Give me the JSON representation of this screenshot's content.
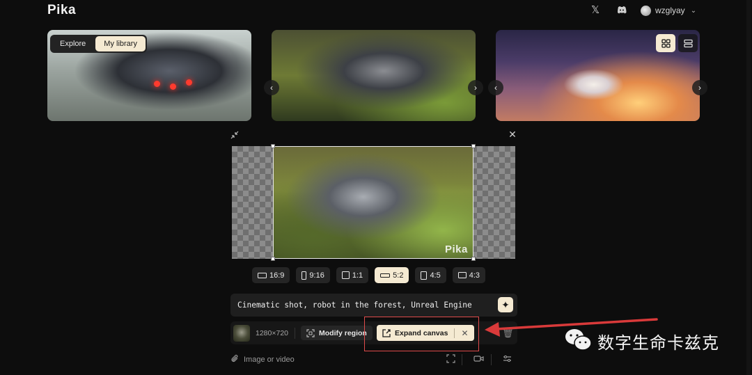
{
  "app": {
    "logo": "Pika"
  },
  "header": {
    "x_icon": "x-twitter-icon",
    "discord_icon": "discord-icon",
    "username": "wzglyay"
  },
  "gallery": {
    "tabs": [
      {
        "label": "Explore",
        "active": false
      },
      {
        "label": "My library",
        "active": true
      }
    ],
    "view_modes": [
      "grid-view",
      "list-view"
    ]
  },
  "editor": {
    "watermark": "Pika",
    "aspect_ratios": [
      {
        "label": "16:9",
        "active": false
      },
      {
        "label": "9:16",
        "active": false
      },
      {
        "label": "1:1",
        "active": false
      },
      {
        "label": "5:2",
        "active": true
      },
      {
        "label": "4:5",
        "active": false
      },
      {
        "label": "4:3",
        "active": false
      }
    ],
    "prompt": "Cinematic shot, robot in the forest, Unreal Engine",
    "resolution": "1280×720",
    "modify_region_label": "Modify region",
    "expand_canvas_label": "Expand canvas",
    "attach_label": "Image or video"
  },
  "overlay": {
    "wechat_text": "数字生命卡兹克",
    "highlight_color": "#e04b4b"
  },
  "colors": {
    "accent": "#f5ead2",
    "background": "#0d0d0d"
  }
}
